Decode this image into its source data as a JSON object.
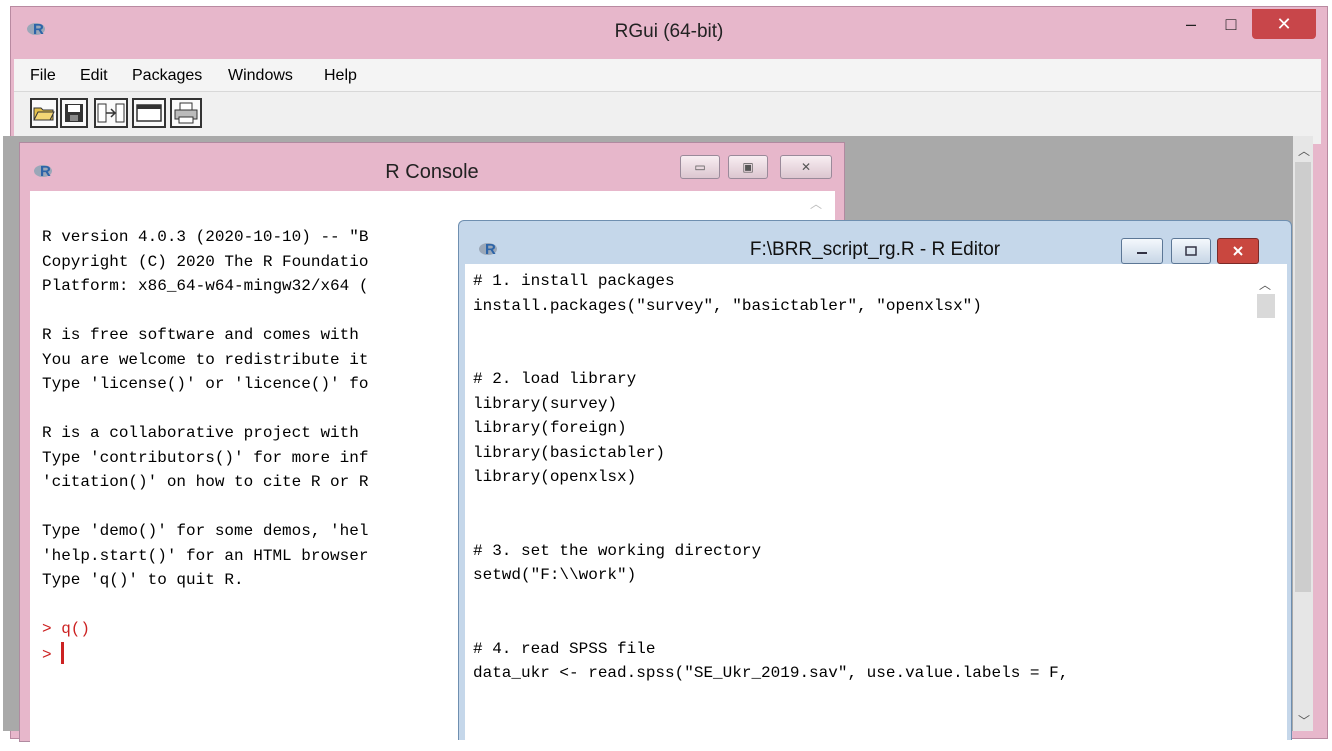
{
  "app": {
    "title": "RGui (64-bit)",
    "minimize_glyph": "–",
    "maximize_glyph": "□",
    "close_glyph": "✕",
    "close_color": "#c8464a"
  },
  "menu": {
    "items": [
      "File",
      "Edit",
      "Packages",
      "Windows",
      "Help"
    ]
  },
  "toolbar": {
    "buttons": [
      "open-script-icon",
      "save-icon",
      "load-workspace-icon",
      "console-window-icon",
      "print-icon"
    ]
  },
  "console": {
    "title": "R Console",
    "lines": [
      "R version 4.0.3 (2020-10-10) -- \"B",
      "Copyright (C) 2020 The R Foundatio",
      "Platform: x86_64-w64-mingw32/x64 (",
      "",
      "R is free software and comes with",
      "You are welcome to redistribute it",
      "Type 'license()' or 'licence()' fo",
      "",
      "R is a collaborative project with",
      "Type 'contributors()' for more inf",
      "'citation()' on how to cite R or R",
      "",
      "Type 'demo()' for some demos, 'hel",
      "'help.start()' for an HTML browser",
      "Type 'q()' to quit R.",
      ""
    ],
    "prompt_lines": [
      "> q()",
      "> "
    ],
    "prompt_color": "#cc2222"
  },
  "editor": {
    "title": "F:\\BRR_script_rg.R - R Editor",
    "close_color": "#c9473f",
    "lines": [
      "# 1. install packages",
      "install.packages(\"survey\", \"basictabler\", \"openxlsx\")",
      "",
      "",
      "# 2. load library",
      "library(survey)",
      "library(foreign)",
      "library(basictabler)",
      "library(openxlsx)",
      "",
      "",
      "# 3. set the working directory",
      "setwd(\"F:\\\\work\")",
      "",
      "",
      "# 4. read SPSS file",
      "data_ukr <- read.spss(\"SE_Ukr_2019.sav\", use.value.labels = F,"
    ]
  }
}
